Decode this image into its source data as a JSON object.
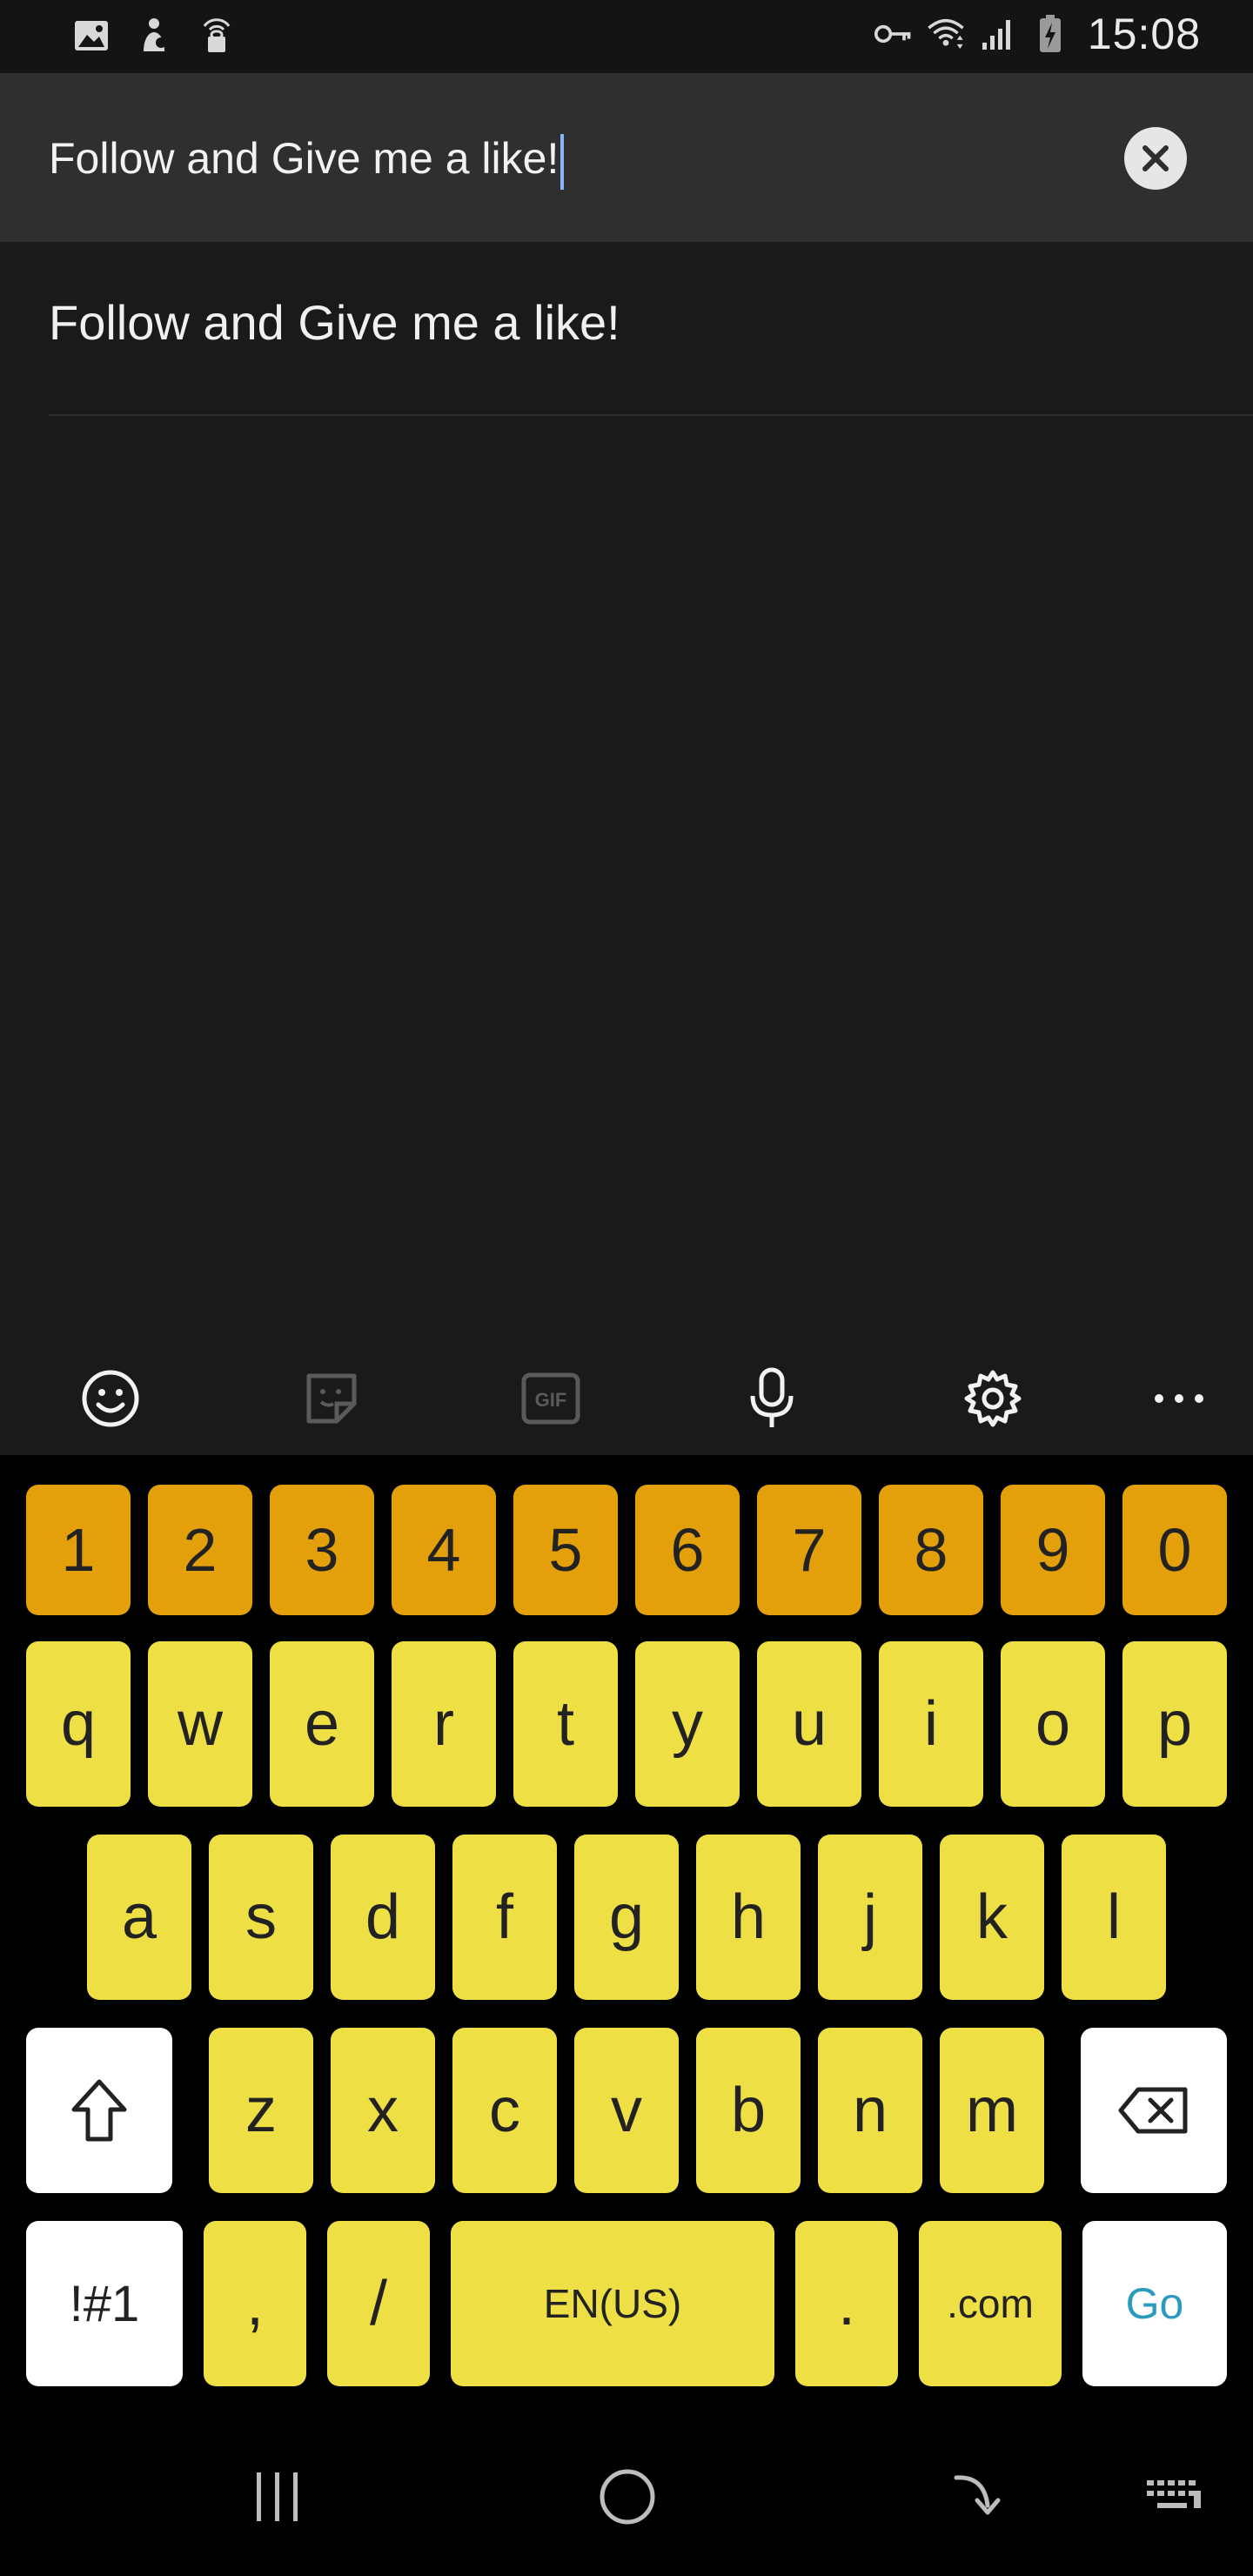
{
  "status_bar": {
    "time": "15:08",
    "left_icons": [
      "image-icon",
      "app-notification-icon",
      "lock-broadcast-icon"
    ],
    "right_icons": [
      "vpn-key-icon",
      "wifi-icon",
      "signal-icon",
      "battery-charging-icon"
    ]
  },
  "search": {
    "value": "Follow and Give me a like!",
    "clear_icon": "close-icon"
  },
  "suggestions": [
    {
      "text": "Follow and Give me a like!"
    }
  ],
  "toolbar": {
    "items": [
      "emoji-icon",
      "sticker-icon",
      "gif-icon",
      "microphone-icon",
      "settings-icon",
      "more-icon"
    ],
    "gif_label": "GIF"
  },
  "keyboard": {
    "number_row": [
      "1",
      "2",
      "3",
      "4",
      "5",
      "6",
      "7",
      "8",
      "9",
      "0"
    ],
    "row1": [
      "q",
      "w",
      "e",
      "r",
      "t",
      "y",
      "u",
      "i",
      "o",
      "p"
    ],
    "row2": [
      "a",
      "s",
      "d",
      "f",
      "g",
      "h",
      "j",
      "k",
      "l"
    ],
    "row3": [
      "z",
      "x",
      "c",
      "v",
      "b",
      "n",
      "m"
    ],
    "symbols_label": "!#1",
    "comma": ",",
    "slash": "/",
    "space_label": "EN(US)",
    "period": ".",
    "dotcom_label": ".com",
    "go_label": "Go",
    "colors": {
      "number_key": "#e3a00a",
      "letter_key": "#eedf45",
      "special_key": "#ffffff",
      "go_text": "#2a9bbf"
    }
  },
  "nav_bar": {
    "items": [
      "recents-icon",
      "home-icon",
      "back-icon",
      "keyboard-hide-icon"
    ]
  }
}
